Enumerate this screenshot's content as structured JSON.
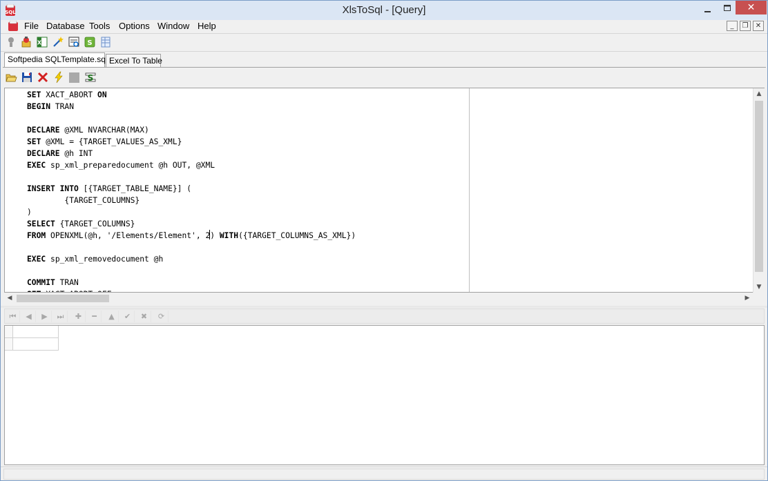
{
  "window": {
    "title": "XlsToSql - [Query]",
    "controls": {
      "minimize": "—",
      "maximize": "☐",
      "close": "✕"
    }
  },
  "menubar": {
    "items": [
      "File",
      "Database",
      "Tools",
      "Options",
      "Window",
      "Help"
    ],
    "mdi_controls": {
      "minimize": "_",
      "restore": "❐",
      "close": "✕"
    }
  },
  "main_toolbar": {
    "icons": [
      "connect-icon",
      "connection-wizard-icon",
      "excel-icon",
      "wand-icon",
      "query-tool-icon",
      "refresh-icon",
      "table-view-icon"
    ]
  },
  "tabs": [
    {
      "label": "Softpedia SQLTemplate.sql",
      "active": true
    },
    {
      "label": "Excel To Table",
      "active": false
    }
  ],
  "editor_toolbar": {
    "icons": [
      "open-folder-icon",
      "save-icon",
      "delete-icon",
      "execute-icon",
      "stop-icon",
      "script-icon"
    ]
  },
  "editor": {
    "lines": [
      "SET XACT_ABORT ON",
      "BEGIN TRAN",
      "",
      "DECLARE @XML NVARCHAR(MAX)",
      "SET @XML = {TARGET_VALUES_AS_XML}",
      "DECLARE @h INT",
      "EXEC sp_xml_preparedocument @h OUT, @XML",
      "",
      "INSERT INTO [{TARGET_TABLE_NAME}] (",
      "        {TARGET_COLUMNS}",
      ")",
      "SELECT {TARGET_COLUMNS}",
      "FROM OPENXML(@h, '/Elements/Element', 2) WITH({TARGET_COLUMNS_AS_XML})",
      "",
      "EXEC sp_xml_removedocument @h",
      "",
      "COMMIT TRAN",
      "SET XACT_ABORT OFF"
    ]
  },
  "navigator": {
    "buttons": [
      "first",
      "prior",
      "next",
      "last",
      "insert",
      "delete",
      "edit",
      "post",
      "cancel",
      "refresh"
    ],
    "glyphs": [
      "⏮",
      "◀",
      "▶",
      "⏭",
      "✚",
      "━",
      "▲",
      "✔",
      "✖",
      "⟳"
    ]
  },
  "status": {
    "text": ""
  },
  "colors": {
    "title_bg": "#dbe6f4",
    "close_bg": "#c75050",
    "chrome": "#f0f0f0"
  }
}
